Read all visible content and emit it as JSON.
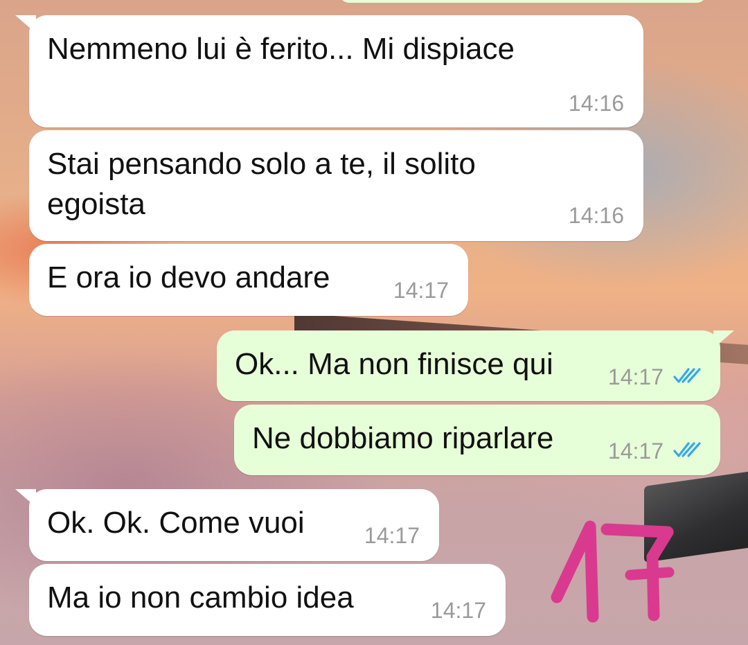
{
  "messages": [
    {
      "direction": "incoming",
      "text": "Nemmeno lui è ferito... Mi dispiace",
      "time": "14:16"
    },
    {
      "direction": "incoming",
      "text": "Stai pensando solo a te, il solito\negoista",
      "time": "14:16"
    },
    {
      "direction": "incoming",
      "text": "E ora io devo andare",
      "time": "14:17"
    },
    {
      "direction": "outgoing",
      "text": "Ok... Ma non finisce qui",
      "time": "14:17",
      "status": "read"
    },
    {
      "direction": "outgoing",
      "text": "Ne dobbiamo riparlare",
      "time": "14:17",
      "status": "read"
    },
    {
      "direction": "incoming",
      "text": "Ok. Ok. Come vuoi",
      "time": "14:17"
    },
    {
      "direction": "incoming",
      "text": "Ma io non cambio idea",
      "time": "14:17"
    }
  ],
  "annotation": {
    "text": "17",
    "color": "#d93a8f"
  },
  "colors": {
    "incoming_bubble": "#ffffff",
    "outgoing_bubble": "#e7ffd8",
    "read_ticks": "#34a9e8",
    "timestamp": "#9a9a9a"
  },
  "icons": {
    "read_status": "double-check-icon"
  }
}
